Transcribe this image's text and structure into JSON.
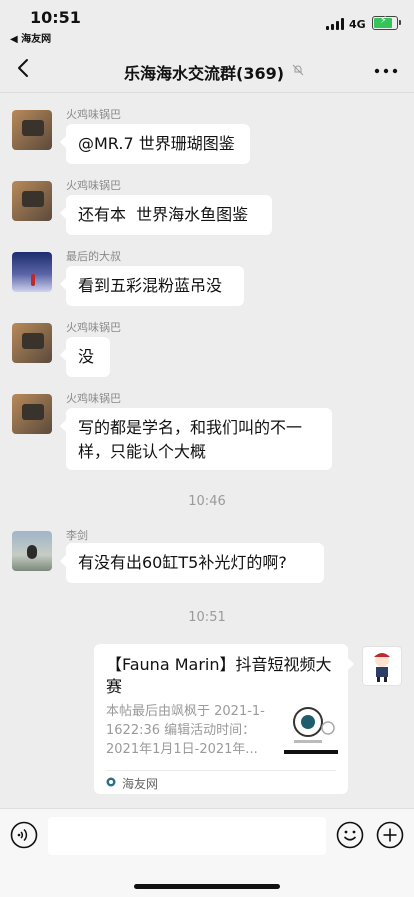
{
  "status": {
    "time": "10:51",
    "back_app": "◀ 海友网",
    "network": "4G"
  },
  "nav": {
    "title": "乐海海水交流群(369)"
  },
  "messages": [
    {
      "sender": "火鸡味锅巴",
      "text": "@MR.7 世界珊瑚图鉴"
    },
    {
      "sender": "火鸡味锅巴",
      "text": "还有本  世界海水鱼图鉴"
    },
    {
      "sender": "最后的大叔",
      "text": "看到五彩混粉蓝吊没"
    },
    {
      "sender": "火鸡味锅巴",
      "text": "没"
    },
    {
      "sender": "火鸡味锅巴",
      "text": "写的都是学名，和我们叫的不一样，只能认个大概"
    },
    {
      "sender": "李剑",
      "text": "有没有出60缸T5补光灯的啊?"
    }
  ],
  "timestamps": [
    "10:46",
    "10:51"
  ],
  "card": {
    "title": "【Fauna Marin】抖音短视频大赛",
    "desc": "本帖最后由飒枫于 2021-1-1622:36 编辑活动时间：2021年1月1日-2021年...",
    "source": "海友网"
  },
  "colors": {
    "background": "#ededed",
    "bubble": "#ffffff",
    "battery": "#36c45a"
  }
}
